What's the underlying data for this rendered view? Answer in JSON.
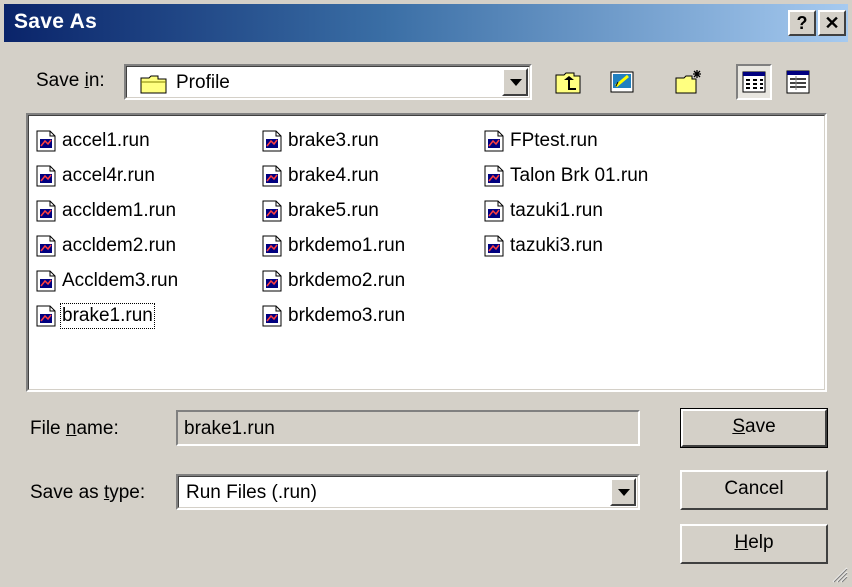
{
  "window": {
    "title": "Save As"
  },
  "titlebar": {
    "help_label": "?",
    "close_label": "✕"
  },
  "save_in": {
    "label_prefix": "Save ",
    "label_accel": "i",
    "label_suffix": "n:",
    "value": "Profile"
  },
  "toolbar": {
    "icons": [
      "up-one-level-icon",
      "desktop-icon",
      "new-folder-icon",
      "list-view-icon",
      "details-view-icon"
    ]
  },
  "files": {
    "columns": [
      [
        "accel1.run",
        "accel4r.run",
        "accldem1.run",
        "accldem2.run",
        "Accldem3.run",
        "brake1.run"
      ],
      [
        "brake3.run",
        "brake4.run",
        "brake5.run",
        "brkdemo1.run",
        "brkdemo2.run",
        "brkdemo3.run"
      ],
      [
        "FPtest.run",
        "Talon Brk 01.run",
        "tazuki1.run",
        "tazuki3.run"
      ]
    ],
    "selected": "brake1.run"
  },
  "file_name": {
    "label_prefix": "File ",
    "label_accel": "n",
    "label_suffix": "ame:",
    "value": "brake1.run"
  },
  "save_type": {
    "label_prefix": "Save as ",
    "label_accel": "t",
    "label_suffix": "ype:",
    "value": "Run Files (.run)"
  },
  "buttons": {
    "save_accel": "S",
    "save_rest": "ave",
    "cancel": "Cancel",
    "help_accel": "H",
    "help_rest": "elp"
  },
  "colors": {
    "titlebar_start": "#0a246a",
    "titlebar_end": "#a6caf0",
    "face": "#d4d0c8"
  }
}
